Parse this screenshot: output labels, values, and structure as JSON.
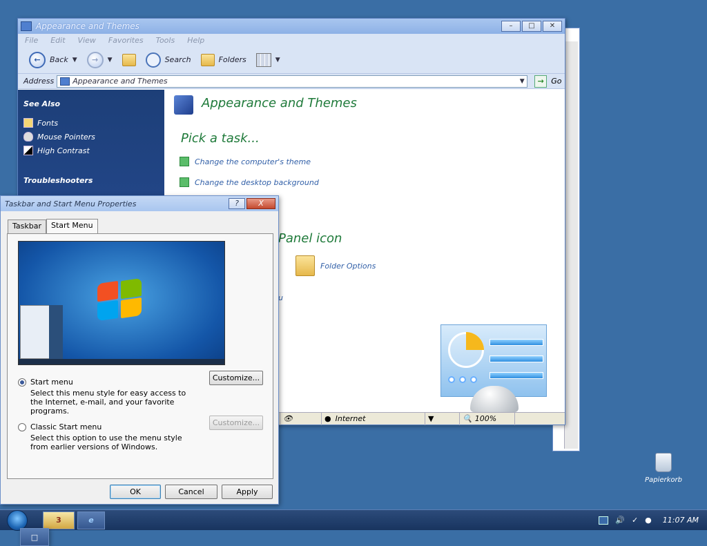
{
  "explorer": {
    "title": "Appearance and Themes",
    "menu": [
      "File",
      "Edit",
      "View",
      "Favorites",
      "Tools",
      "Help"
    ],
    "toolbar": {
      "back_label": "Back",
      "search_label": "Search",
      "folders_label": "Folders"
    },
    "address": {
      "label": "Address",
      "value": "Appearance and Themes",
      "go_label": "Go"
    },
    "sidebar": {
      "see_also_heading": "See Also",
      "items": [
        "Fonts",
        "Mouse Pointers",
        "High Contrast"
      ],
      "troubleshooters_heading": "Troubleshooters"
    },
    "main": {
      "category_title": "Appearance and Themes",
      "pick_task_title": "Pick a task...",
      "tasks": [
        "Change the computer's theme",
        "Change the desktop background"
      ],
      "panel_icon_title": "Panel icon",
      "folder_options_label": "Folder Options",
      "stray_text": "u"
    },
    "status": {
      "zone": "Internet",
      "zoom": "100%"
    }
  },
  "dialog": {
    "title": "Taskbar and Start Menu Properties",
    "help_glyph": "?",
    "close_glyph": "X",
    "tabs": [
      "Taskbar",
      "Start Menu"
    ],
    "active_tab": "Start Menu",
    "options": [
      {
        "label": "Start menu",
        "selected": true,
        "description": "Select this menu style for easy access to the Internet, e-mail, and your favorite programs.",
        "button": "Customize...",
        "button_enabled": true
      },
      {
        "label": "Classic Start menu",
        "selected": false,
        "description": "Select this option to use the menu style from earlier versions of Windows.",
        "button": "Customize...",
        "button_enabled": false
      }
    ],
    "buttons": {
      "ok": "OK",
      "cancel": "Cancel",
      "apply": "Apply"
    }
  },
  "desktop": {
    "recycle_bin_label": "Papierkorb"
  },
  "taskbar": {
    "folder_count": "3",
    "clock": "11:07 AM"
  },
  "colors": {
    "desktop": "#3a6ea5",
    "link": "#3260a8",
    "heading_green": "#1f7a3a",
    "sidebar_dark": "#1d3f78"
  }
}
